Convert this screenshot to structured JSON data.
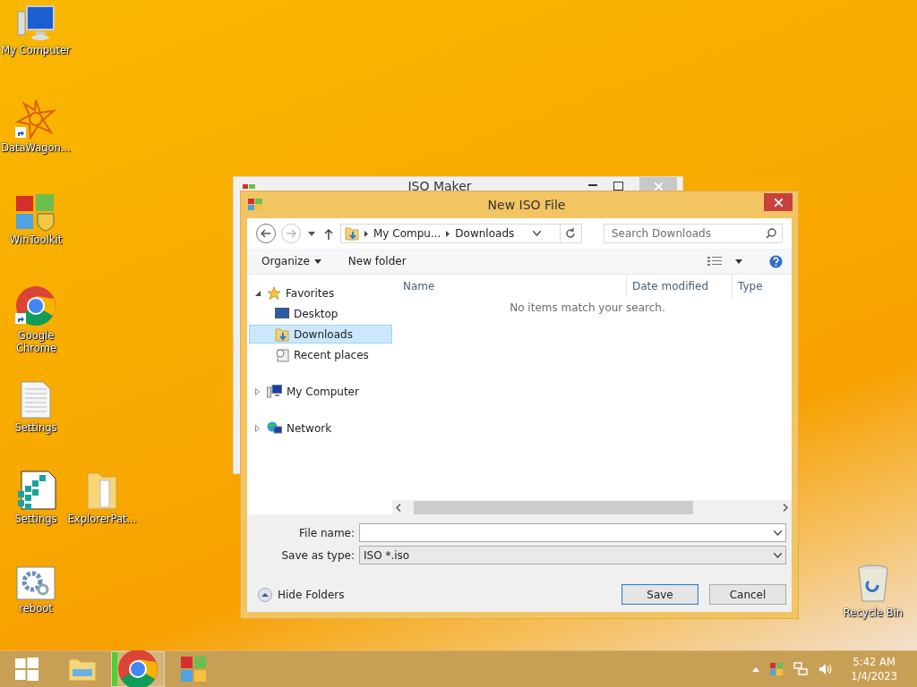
{
  "desktop_icons": [
    {
      "label": "My Computer",
      "kind": "computer"
    },
    {
      "label": "DataWagon...",
      "kind": "star",
      "shortcut": true
    },
    {
      "label": "WinToolkit",
      "kind": "toolkit",
      "shortcut": false
    },
    {
      "label": "Google Chrome",
      "kind": "chrome",
      "shortcut": true
    },
    {
      "label": "Settings",
      "kind": "document",
      "shortcut": false
    },
    {
      "label": "Settings",
      "kind": "registry",
      "shortcut": false
    },
    {
      "label": "ExplorerPat...",
      "kind": "folder",
      "shortcut": false
    },
    {
      "label": "reboot",
      "kind": "gears",
      "shortcut": false
    },
    {
      "label": "Recycle Bin",
      "kind": "bin",
      "shortcut": false
    }
  ],
  "background_window": {
    "title": "ISO Maker"
  },
  "dialog": {
    "title": "New ISO File",
    "address": {
      "crumbs": [
        "My Compu...",
        "Downloads"
      ]
    },
    "search": {
      "placeholder": "Search Downloads"
    },
    "toolbar": {
      "organize": "Organize",
      "new_folder": "New folder"
    },
    "nav_tree": [
      {
        "label": "Favorites",
        "kind": "star",
        "expanded": true,
        "selected": false,
        "children": [
          {
            "label": "Desktop",
            "kind": "desktop",
            "selected": false
          },
          {
            "label": "Downloads",
            "kind": "downloads",
            "selected": true
          },
          {
            "label": "Recent places",
            "kind": "recent",
            "selected": false
          }
        ]
      },
      {
        "label": "My Computer",
        "kind": "computer",
        "expanded": false,
        "selected": false
      },
      {
        "label": "Network",
        "kind": "network",
        "expanded": false,
        "selected": false
      }
    ],
    "columns": [
      "Name",
      "Date modified",
      "Type"
    ],
    "empty_message": "No items match your search.",
    "file_name": {
      "label": "File name:"
    },
    "save_type": {
      "label": "Save as type:",
      "value": "ISO *.iso"
    },
    "hide_folders": "Hide Folders",
    "buttons": [
      {
        "label": "Save",
        "default": true
      },
      {
        "label": "Cancel",
        "default": false
      }
    ]
  },
  "taskbar": {
    "items": [
      {
        "kind": "start",
        "active": false
      },
      {
        "kind": "explorer",
        "active": false
      },
      {
        "kind": "chrome",
        "active": true
      },
      {
        "kind": "toolkit",
        "active": false
      }
    ],
    "time": "5:42 AM",
    "date": "1/4/2023"
  }
}
